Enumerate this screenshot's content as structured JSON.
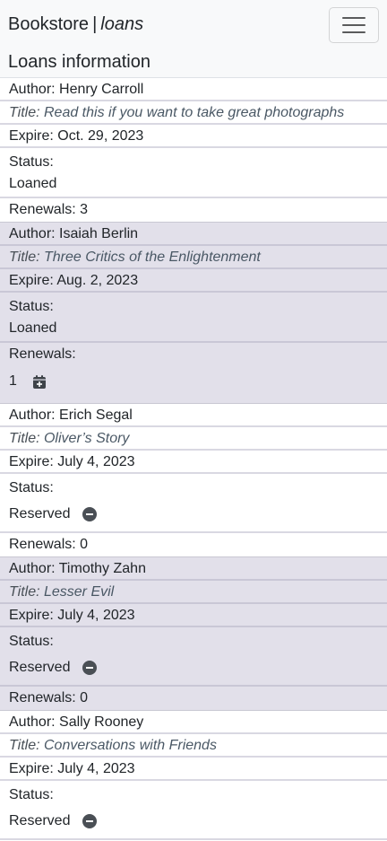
{
  "navbar": {
    "brand": "Bookstore",
    "separator": "|",
    "section": "loans",
    "toggler_icon": "hamburger-icon"
  },
  "heading": "Loans information",
  "labels": {
    "author": "Author: ",
    "title": "Title: ",
    "expire": "Expire: ",
    "status": "Status:",
    "renewals": "Renewals: "
  },
  "loans": [
    {
      "author": "Henry Carroll",
      "title": "Read this if you want to take great photographs",
      "expire": "Oct. 29, 2023",
      "status": "Loaned",
      "renewals": "3"
    },
    {
      "author": "Isaiah Berlin",
      "title": "Three Critics of the Enlightenment",
      "expire": "Aug. 2, 2023",
      "status": "Loaned",
      "renewals": "1",
      "renew_icon": "calendar-plus-icon"
    },
    {
      "author": "Erich Segal",
      "title": "Oliver’s Story",
      "expire": "July 4, 2023",
      "status": "Reserved",
      "status_icon": "dash-circle-icon",
      "renewals": "0"
    },
    {
      "author": "Timothy Zahn",
      "title": "Lesser Evil",
      "expire": "July 4, 2023",
      "status": "Reserved",
      "status_icon": "dash-circle-icon",
      "renewals": "0"
    },
    {
      "author": "Sally Rooney",
      "title": "Conversations with Friends",
      "expire": "July 4, 2023",
      "status": "Reserved",
      "status_icon": "dash-circle-icon",
      "renewals": "0"
    }
  ]
}
